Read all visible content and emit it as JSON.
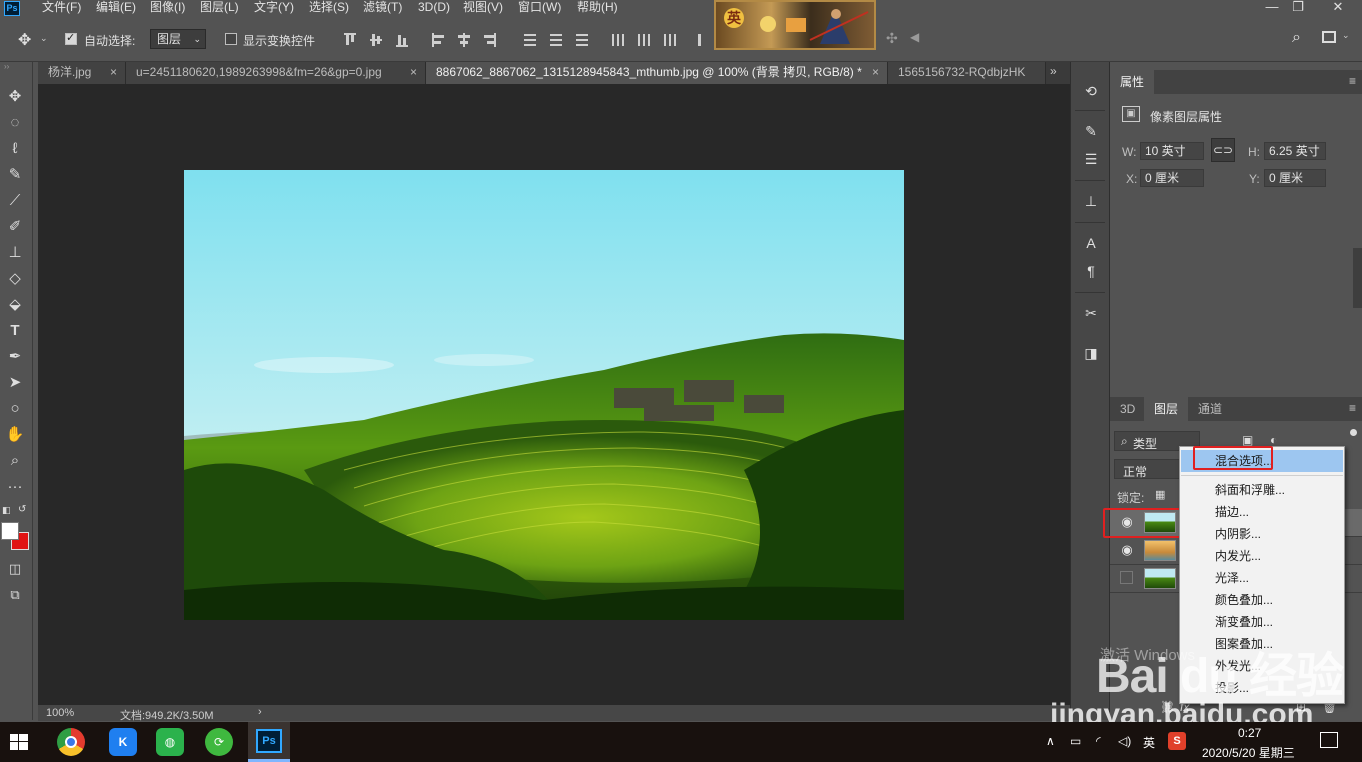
{
  "menubar": {
    "items": [
      "文件(F)",
      "编辑(E)",
      "图像(I)",
      "图层(L)",
      "文字(Y)",
      "选择(S)",
      "滤镜(T)",
      "3D(D)",
      "视图(V)",
      "窗口(W)",
      "帮助(H)"
    ],
    "ad_glyph": "英"
  },
  "options": {
    "auto_select_label": "自动选择:",
    "auto_select_target": "图层",
    "show_transform_label": "显示变换控件"
  },
  "tabs": [
    {
      "label": "杨洋.jpg",
      "close": "×",
      "active": false
    },
    {
      "label": "u=2451180620,1989263998&fm=26&gp=0.jpg",
      "close": "×",
      "active": false
    },
    {
      "label": "8867062_8867062_1315128945843_mthumb.jpg @ 100% (背景 拷贝, RGB/8) *",
      "close": "×",
      "active": true
    },
    {
      "label": "1565156732-RQdbjzHK",
      "close": "",
      "active": false
    }
  ],
  "tabs_overflow": "»",
  "status": {
    "zoom": "100%",
    "doc": "文档:949.2K/3.50M",
    "arrow": "›"
  },
  "properties": {
    "tab": "属性",
    "subtitle": "像素图层属性",
    "w_label": "W:",
    "w_value": "10 英寸",
    "h_label": "H:",
    "h_value": "6.25 英寸",
    "x_label": "X:",
    "x_value": "0 厘米",
    "y_label": "Y:",
    "y_value": "0 厘米"
  },
  "layers_panel": {
    "tabs": [
      "3D",
      "图层",
      "通道"
    ],
    "active_tab": "图层",
    "filter_label": "类型",
    "blend_mode": "正常",
    "lock_label": "锁定:"
  },
  "context_menu": {
    "items": [
      "混合选项...",
      "斜面和浮雕...",
      "描边...",
      "内阴影...",
      "内发光...",
      "光泽...",
      "颜色叠加...",
      "渐变叠加...",
      "图案叠加...",
      "外发光...",
      "投影..."
    ],
    "highlighted": "混合选项..."
  },
  "watermark": {
    "line1": "激活 Windows",
    "line2": "Bai du 经验",
    "line3": "jingyan.baidu.com"
  },
  "taskbar": {
    "ime": "英",
    "time": "0:27",
    "date": "2020/5/20 星期三",
    "apps": [
      "windows-start",
      "chrome",
      "kugou",
      "wechat",
      "green-app",
      "photoshop"
    ]
  },
  "colors": {
    "ui_bg": "#535353",
    "canvas_bg": "#282828",
    "highlight": "#9dc6f0",
    "annotation_red": "#e02020",
    "foreground_swatch": "#ffffff",
    "background_swatch": "#e01414"
  }
}
